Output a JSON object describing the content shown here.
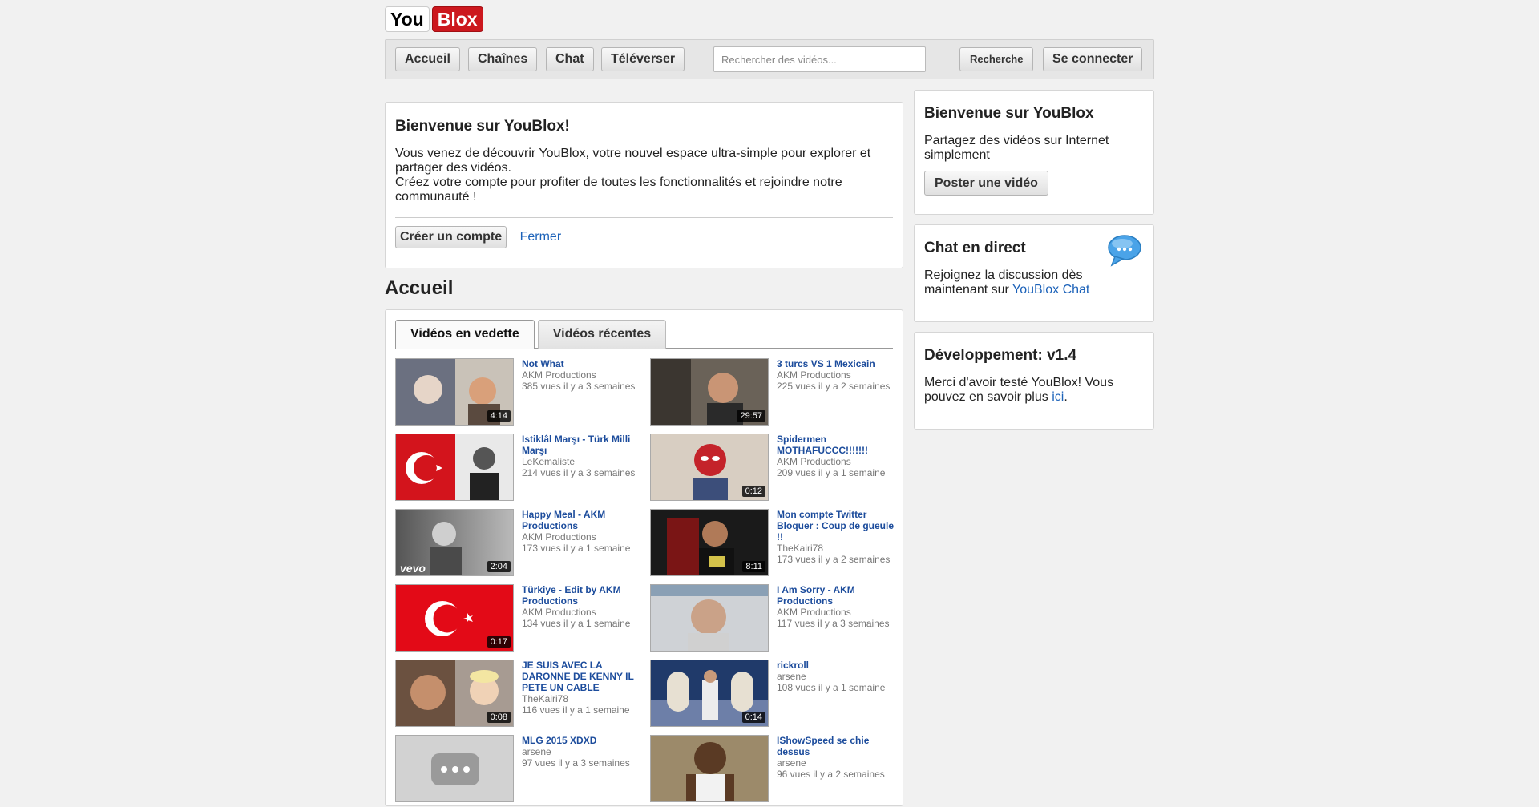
{
  "logo": {
    "part1": "You",
    "part2": "Blox"
  },
  "nav": {
    "home": "Accueil",
    "channels": "Chaînes",
    "chat": "Chat",
    "upload": "Téléverser",
    "search_placeholder": "Rechercher des vidéos...",
    "search_button": "Recherche",
    "login": "Se connecter"
  },
  "welcome": {
    "title": "Bienvenue sur YouBlox!",
    "line1": "Vous venez de découvrir YouBlox, votre nouvel espace ultra-simple pour explorer et partager des vidéos.",
    "line2": "Créez votre compte pour profiter de toutes les fonctionnalités et rejoindre notre communauté !",
    "create_button": "Créer un compte",
    "close_link": "Fermer"
  },
  "section_title": "Accueil",
  "tabs": [
    "Vidéos en vedette",
    "Vidéos récentes"
  ],
  "videos": [
    {
      "title": "Not What",
      "author": "AKM Productions",
      "stats": "385 vues  il y a 3 semaines",
      "duration": "4:14"
    },
    {
      "title": "3 turcs VS 1 Mexicain",
      "author": "AKM Productions",
      "stats": "225 vues  il y a 2 semaines",
      "duration": "29:57"
    },
    {
      "title": "Istiklâl Marşı - Türk Milli Marşı",
      "author": "LeKemaliste",
      "stats": "214 vues  il y a 3 semaines",
      "duration": ""
    },
    {
      "title": "Spidermen MOTHAFUCCC!!!!!!!",
      "author": "AKM Productions",
      "stats": "209 vues  il y a 1 semaine",
      "duration": "0:12"
    },
    {
      "title": "Happy Meal - AKM Productions",
      "author": "AKM Productions",
      "stats": "173 vues  il y a 1 semaine",
      "duration": "2:04"
    },
    {
      "title": "Mon compte Twitter Bloquer : Coup de gueule !!",
      "author": "TheKairi78",
      "stats": "173 vues  il y a 2 semaines",
      "duration": "8:11"
    },
    {
      "title": "Türkiye - Edit by AKM Productions",
      "author": "AKM Productions",
      "stats": "134 vues  il y a 1 semaine",
      "duration": "0:17"
    },
    {
      "title": "I Am Sorry - AKM Productions",
      "author": "AKM Productions",
      "stats": "117 vues  il y a 3 semaines",
      "duration": ""
    },
    {
      "title": "JE SUIS AVEC LA DARONNE DE KENNY IL PETE UN CABLE",
      "author": "TheKairi78",
      "stats": "116 vues  il y a 1 semaine",
      "duration": "0:08"
    },
    {
      "title": "rickroll",
      "author": "arsene",
      "stats": "108 vues  il y a 1 semaine",
      "duration": "0:14"
    },
    {
      "title": "MLG 2015 XDXD",
      "author": "arsene",
      "stats": "97 vues  il y a 3 semaines",
      "duration": ""
    },
    {
      "title": "IShowSpeed se chie dessus",
      "author": "arsene",
      "stats": "96 vues  il y a 2 semaines",
      "duration": ""
    }
  ],
  "vevo_label": "vevo",
  "sidebar": {
    "welcome_title": "Bienvenue sur YouBlox",
    "welcome_text": "Partagez des vidéos sur Internet simplement",
    "post_button": "Poster une vidéo",
    "chat_title": "Chat en direct",
    "chat_text": "Rejoignez la discussion dès maintenant sur ",
    "chat_link": "YouBlox Chat",
    "dev_title": "Développement: v1.4",
    "dev_text": "Merci d'avoir testé YouBlox! Vous pouvez en savoir plus ",
    "dev_link": "ici",
    "dev_suffix": "."
  },
  "colors": {
    "brand_red": "#cc181e",
    "link_blue": "#1c62b9",
    "title_blue": "#1c4c9c"
  }
}
